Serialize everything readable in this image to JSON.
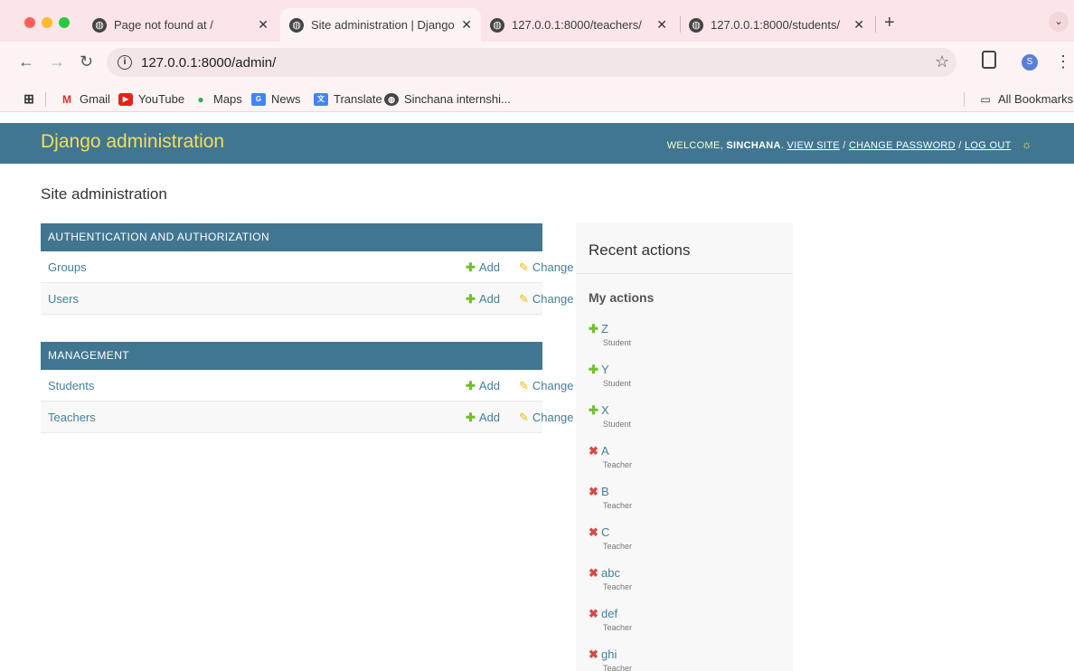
{
  "browser": {
    "traffic_colors": [
      "#ff5f57",
      "#febc2e",
      "#28c840"
    ],
    "tabs": [
      {
        "title": "Page not found at /"
      },
      {
        "title": "Site administration | Django s"
      },
      {
        "title": "127.0.0.1:8000/teachers/"
      },
      {
        "title": "127.0.0.1:8000/students/"
      }
    ],
    "new_tab": "+",
    "tab_menu_icon": "chevron-down-icon",
    "url": "127.0.0.1:8000/admin/",
    "profile_initial": "S",
    "bookmarks": [
      {
        "label": "Gmail",
        "icon": "gmail-icon"
      },
      {
        "label": "YouTube",
        "icon": "youtube-icon"
      },
      {
        "label": "Maps",
        "icon": "maps-icon"
      },
      {
        "label": "News",
        "icon": "news-icon"
      },
      {
        "label": "Translate",
        "icon": "translate-icon"
      },
      {
        "label": "Sinchana internshi...",
        "icon": "globe-icon"
      }
    ],
    "all_bookmarks": "All Bookmarks"
  },
  "admin": {
    "brand": "Django administration",
    "welcome": "WELCOME,",
    "username": "SINCHANA",
    "view_site": "VIEW SITE",
    "change_password": "CHANGE PASSWORD",
    "log_out": "LOG OUT",
    "separator": "/",
    "header_color": "#417690",
    "brand_color": "#f5dd5d",
    "page_title": "Site administration",
    "modules": [
      {
        "caption": "AUTHENTICATION AND AUTHORIZATION",
        "rows": [
          {
            "name": "Groups",
            "add": "Add",
            "change": "Change"
          },
          {
            "name": "Users",
            "add": "Add",
            "change": "Change"
          }
        ]
      },
      {
        "caption": "MANAGEMENT",
        "rows": [
          {
            "name": "Students",
            "add": "Add",
            "change": "Change"
          },
          {
            "name": "Teachers",
            "add": "Add",
            "change": "Change"
          }
        ]
      }
    ],
    "recent": {
      "title": "Recent actions",
      "subtitle": "My actions",
      "items": [
        {
          "kind": "add",
          "name": "Z",
          "type": "Student"
        },
        {
          "kind": "add",
          "name": "Y",
          "type": "Student"
        },
        {
          "kind": "add",
          "name": "X",
          "type": "Student"
        },
        {
          "kind": "delete",
          "name": "A",
          "type": "Teacher"
        },
        {
          "kind": "delete",
          "name": "B",
          "type": "Teacher"
        },
        {
          "kind": "delete",
          "name": "C",
          "type": "Teacher"
        },
        {
          "kind": "delete",
          "name": "abc",
          "type": "Teacher"
        },
        {
          "kind": "delete",
          "name": "def",
          "type": "Teacher"
        },
        {
          "kind": "delete",
          "name": "ghi",
          "type": "Teacher"
        }
      ]
    }
  }
}
